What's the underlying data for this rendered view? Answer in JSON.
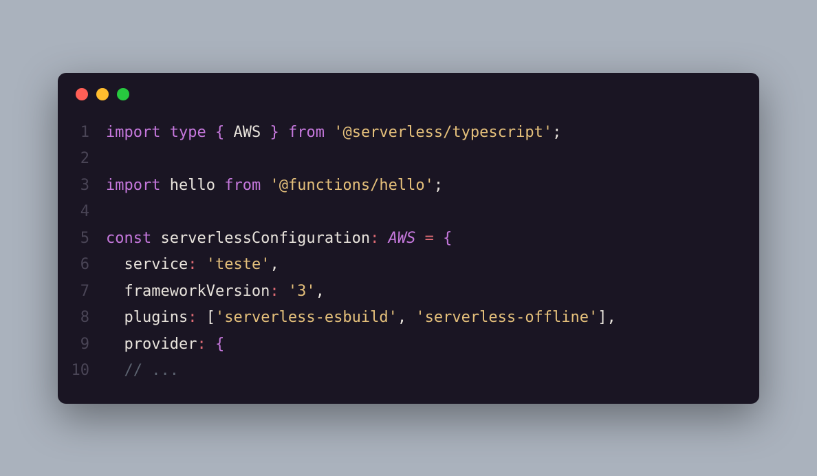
{
  "window": {
    "lights": {
      "red": "close-icon",
      "yellow": "minimize-icon",
      "green": "maximize-icon"
    }
  },
  "code": {
    "lines": {
      "l1": "1",
      "l2": "2",
      "l3": "3",
      "l4": "4",
      "l5": "5",
      "l6": "6",
      "l7": "7",
      "l8": "8",
      "l9": "9",
      "l10": "10"
    },
    "tokens": {
      "import1": "import",
      "type1": "type",
      "braceOpen1": "{ ",
      "aws1": "AWS",
      "braceClose1": " }",
      "from1": "from",
      "string1": "'@serverless/typescript'",
      "semi1": ";",
      "import2": "import",
      "hello": "hello",
      "from2": "from",
      "string2": "'@functions/hello'",
      "semi2": ";",
      "const1": "const",
      "configName": "serverlessConfiguration",
      "colon1": ":",
      "awsType": "AWS",
      "equals": "=",
      "openBrace": "{",
      "service": "service",
      "colonS": ":",
      "serviceVal": "'teste'",
      "comma1": ",",
      "fw": "frameworkVersion",
      "colonF": ":",
      "fwVal": "'3'",
      "comma2": ",",
      "plugins": "plugins",
      "colonP": ":",
      "bracketOpen": "[",
      "plugin1": "'serverless-esbuild'",
      "comma3": ",",
      "plugin2": "'serverless-offline'",
      "bracketClose": "]",
      "comma4": ",",
      "provider": "provider",
      "colonPr": ":",
      "openBrace2": "{",
      "comment": "// ..."
    }
  }
}
